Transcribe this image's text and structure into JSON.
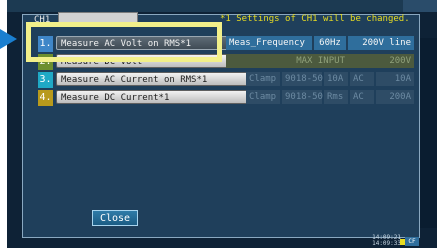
{
  "channel": {
    "label": "CH1",
    "value": ""
  },
  "notice": "*1 Settings of CH1 will be changed.",
  "menu": [
    {
      "num": "1.",
      "label": "Measure AC Volt on RMS*1",
      "num_color": "#3f86c8"
    },
    {
      "num": "2.",
      "label": "Measure DC Volt",
      "num_color": "#6c8f2f"
    },
    {
      "num": "3.",
      "label": "Measure AC Current on RMS*1",
      "num_color": "#1fa9c6"
    },
    {
      "num": "4.",
      "label": "Measure DC Current*1",
      "num_color": "#b89a1c"
    }
  ],
  "row1_tags": {
    "meas": "Meas_Frequency",
    "freq": "60Hz",
    "range": "200V line"
  },
  "row2_tags": {
    "max_input": "MAX INPUT",
    "value": "200V"
  },
  "row3_tags": {
    "clamp": "Clamp",
    "model": "9018-50",
    "val": "10A",
    "ac": "AC",
    "range": "10A"
  },
  "row4_tags": {
    "clamp": "Clamp",
    "model": "9018-50",
    "rms": "Rms",
    "ac": "AC",
    "range": "200A"
  },
  "close_label": "Close",
  "status": {
    "date": "14:09:21",
    "time": "14:09:33",
    "icon": "CF"
  },
  "accent_colors": {
    "arrow": "#1a7fd0",
    "highlight": "#f2f08a",
    "notice": "#e8dc22"
  }
}
